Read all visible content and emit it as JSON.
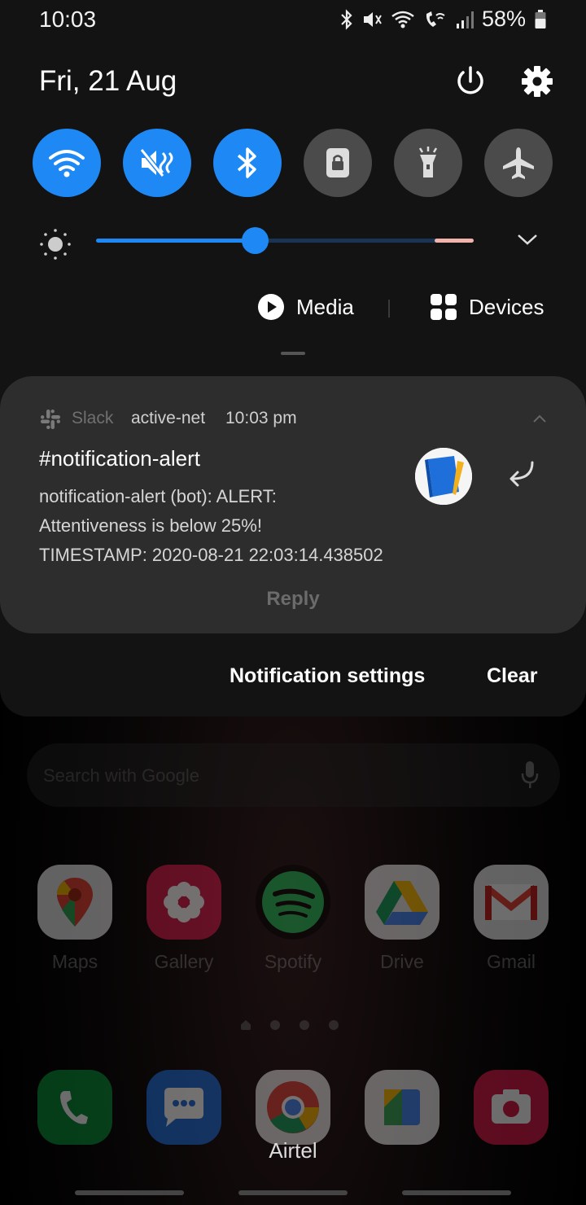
{
  "status_bar": {
    "time": "10:03",
    "battery_percent": "58%",
    "icons": [
      "bluetooth-icon",
      "mute-icon",
      "wifi-icon",
      "wifi-calling-icon",
      "signal-icon",
      "battery-icon"
    ]
  },
  "header": {
    "date": "Fri, 21 Aug"
  },
  "quick_settings": {
    "tiles": [
      {
        "name": "wifi",
        "on": true
      },
      {
        "name": "mute",
        "on": true
      },
      {
        "name": "bluetooth",
        "on": true
      },
      {
        "name": "portrait-lock",
        "on": false
      },
      {
        "name": "flashlight",
        "on": false
      },
      {
        "name": "airplane-mode",
        "on": false
      }
    ],
    "brightness_level": 0.42,
    "media_label": "Media",
    "devices_label": "Devices"
  },
  "notification": {
    "app": "Slack",
    "workspace": "active-net",
    "time": "10:03 pm",
    "title": "#notification-alert",
    "body_line1": "notification-alert (bot): ALERT:",
    "body_line2": "Attentiveness is below 25%!",
    "body_line3": "TIMESTAMP: 2020-08-21 22:03:14.438502",
    "reply_label": "Reply"
  },
  "shade_actions": {
    "settings_label": "Notification settings",
    "clear_label": "Clear"
  },
  "home": {
    "search_placeholder": "Search with Google",
    "apps": [
      {
        "label": "Maps"
      },
      {
        "label": "Gallery"
      },
      {
        "label": "Spotify"
      },
      {
        "label": "Drive"
      },
      {
        "label": "Gmail"
      }
    ],
    "carrier": "Airtel"
  },
  "colors": {
    "accent": "#1e88f5",
    "tile_off": "#4b4b4b",
    "card": "#2d2d2d",
    "shade": "#131313"
  }
}
